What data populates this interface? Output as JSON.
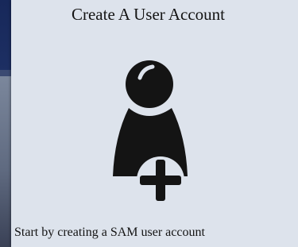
{
  "card": {
    "title": "Create A User Account",
    "description": "Start by creating a SAM user account",
    "icon": "add-user-icon"
  },
  "colors": {
    "header_bg": "#17285a",
    "card_bg": "#dde3ec",
    "icon_color": "#141414",
    "text_color": "#141414"
  }
}
